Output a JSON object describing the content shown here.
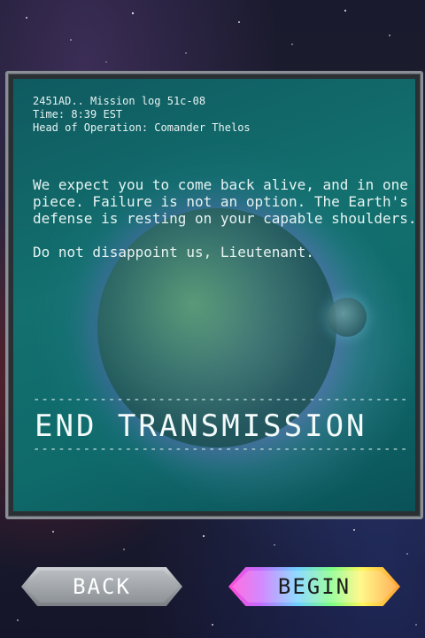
{
  "log": {
    "line1": "2451AD.. Mission log 51c-08",
    "line2": "Time: 8:39 EST",
    "line3": "Head of Operation: Comander Thelos"
  },
  "message": {
    "paragraph1": "We expect you to come back alive, and in one piece. Failure is not an option. The Earth's defense is resting on your capable shoulders.",
    "paragraph2": "Do not disappoint us, Lieutenant."
  },
  "transmission": {
    "separator": "----------------------------------------------",
    "title": "END TRANSMISSION"
  },
  "buttons": {
    "back": "BACK",
    "begin": "BEGIN"
  }
}
